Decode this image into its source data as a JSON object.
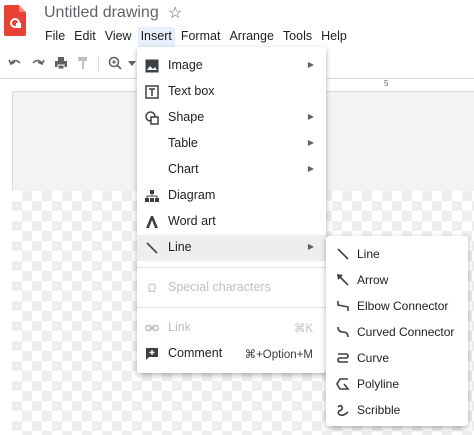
{
  "app": {
    "title": "Untitled drawing",
    "star_glyph": "☆",
    "brand_color": "#e94235"
  },
  "menubar": {
    "items": [
      "File",
      "Edit",
      "View",
      "Insert",
      "Format",
      "Arrange",
      "Tools",
      "Help"
    ],
    "active": "Insert"
  },
  "toolbar": {
    "icons": [
      "undo-icon",
      "redo-icon",
      "print-icon",
      "paint-format-icon",
      "zoom-icon",
      "dropdown-icon"
    ]
  },
  "ruler": {
    "label": "5"
  },
  "insert_menu": {
    "items": [
      {
        "label": "Image",
        "icon": "image-icon",
        "submenu": true
      },
      {
        "label": "Text box",
        "icon": "text-box-icon",
        "submenu": false
      },
      {
        "label": "Shape",
        "icon": "shape-icon",
        "submenu": true
      },
      {
        "label": "Table",
        "icon": "",
        "submenu": true
      },
      {
        "label": "Chart",
        "icon": "",
        "submenu": true
      },
      {
        "label": "Diagram",
        "icon": "diagram-icon",
        "submenu": false
      },
      {
        "label": "Word art",
        "icon": "word-art-icon",
        "submenu": false
      },
      {
        "label": "Line",
        "icon": "line-icon",
        "submenu": true,
        "highlighted": true
      },
      {
        "label": "Special characters",
        "icon": "special-characters-icon",
        "disabled": true
      },
      {
        "label": "Link",
        "icon": "link-icon",
        "shortcut": "⌘K",
        "disabled": true
      },
      {
        "label": "Comment",
        "icon": "comment-icon",
        "shortcut": "⌘+Option+M"
      }
    ]
  },
  "line_submenu": {
    "items": [
      {
        "label": "Line",
        "icon": "line-icon"
      },
      {
        "label": "Arrow",
        "icon": "arrow-icon"
      },
      {
        "label": "Elbow Connector",
        "icon": "elbow-connector-icon"
      },
      {
        "label": "Curved Connector",
        "icon": "curved-connector-icon"
      },
      {
        "label": "Curve",
        "icon": "curve-icon"
      },
      {
        "label": "Polyline",
        "icon": "polyline-icon"
      },
      {
        "label": "Scribble",
        "icon": "scribble-icon"
      }
    ]
  },
  "colors": {
    "highlight": "#eeeeee",
    "menu_active": "#e8f0fe",
    "disabled_text": "#bdc1c6"
  }
}
